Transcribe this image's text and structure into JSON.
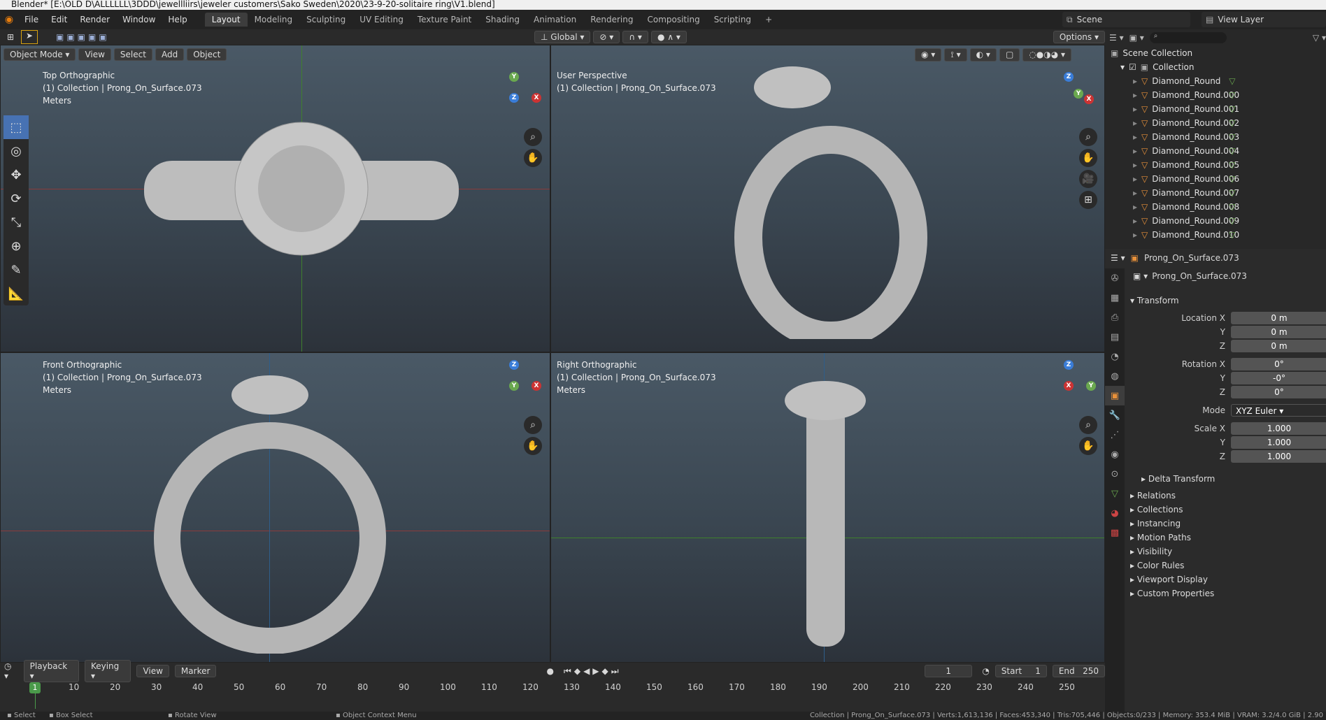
{
  "window_title": "Blender* [E:\\OLD D\\ALLLLLL\\3DDD\\jewellliirs\\jeweler customers\\Sako Sweden\\2020\\23-9-20-solitaire ring\\V1.blend]",
  "menu": [
    "File",
    "Edit",
    "Render",
    "Window",
    "Help"
  ],
  "workspaces": [
    "Layout",
    "Modeling",
    "Sculpting",
    "UV Editing",
    "Texture Paint",
    "Shading",
    "Animation",
    "Rendering",
    "Compositing",
    "Scripting"
  ],
  "active_workspace": "Layout",
  "scene": "Scene",
  "view_layer": "View Layer",
  "header": {
    "mode": "Object Mode",
    "view": "View",
    "select": "Select",
    "add": "Add",
    "object": "Object",
    "orientation": "Global",
    "options": "Options"
  },
  "viewports": [
    {
      "name": "Top Orthographic",
      "collection": "(1) Collection | Prong_On_Surface.073",
      "units": "Meters"
    },
    {
      "name": "User Perspective",
      "collection": "(1) Collection | Prong_On_Surface.073"
    },
    {
      "name": "Front Orthographic",
      "collection": "(1) Collection | Prong_On_Surface.073",
      "units": "Meters"
    },
    {
      "name": "Right Orthographic",
      "collection": "(1) Collection | Prong_On_Surface.073",
      "units": "Meters"
    }
  ],
  "outliner": {
    "root": "Scene Collection",
    "collection": "Collection",
    "items": [
      "Diamond_Round",
      "Diamond_Round.000",
      "Diamond_Round.001",
      "Diamond_Round.002",
      "Diamond_Round.003",
      "Diamond_Round.004",
      "Diamond_Round.005",
      "Diamond_Round.006",
      "Diamond_Round.007",
      "Diamond_Round.008",
      "Diamond_Round.009",
      "Diamond_Round.010"
    ]
  },
  "properties": {
    "object_name": "Prong_On_Surface.073",
    "data_name": "Prong_On_Surface.073",
    "transform_title": "Transform",
    "location_label": "Location X",
    "location": [
      "0 m",
      "0 m",
      "0 m"
    ],
    "rotation_label": "Rotation X",
    "rotation": [
      "0°",
      "-0°",
      "0°"
    ],
    "mode_label": "Mode",
    "mode": "XYZ Euler",
    "scale_label": "Scale X",
    "scale": [
      "1.000",
      "1.000",
      "1.000"
    ],
    "axis_y": "Y",
    "axis_z": "Z",
    "delta": "Delta Transform",
    "sections": [
      "Relations",
      "Collections",
      "Instancing",
      "Motion Paths",
      "Visibility",
      "Color Rules",
      "Viewport Display",
      "Custom Properties"
    ]
  },
  "timeline": {
    "playback": "Playback",
    "keying": "Keying",
    "view": "View",
    "marker": "Marker",
    "current_frame": "1",
    "start_label": "Start",
    "start": "1",
    "end_label": "End",
    "end": "250",
    "ticks": [
      "10",
      "20",
      "30",
      "40",
      "50",
      "60",
      "70",
      "80",
      "90",
      "100",
      "110",
      "120",
      "130",
      "140",
      "150",
      "160",
      "170",
      "180",
      "190",
      "200",
      "210",
      "220",
      "230",
      "240",
      "250"
    ]
  },
  "status": {
    "select": "Select",
    "box_select": "Box Select",
    "rotate_view": "Rotate View",
    "context_menu": "Object Context Menu",
    "info": "Collection | Prong_On_Surface.073 | Verts:1,613,136 | Faces:453,340 | Tris:705,446 | Objects:0/233 | Memory: 353.4 MiB | VRAM: 3.2/4.0 GiB | 2.90"
  }
}
